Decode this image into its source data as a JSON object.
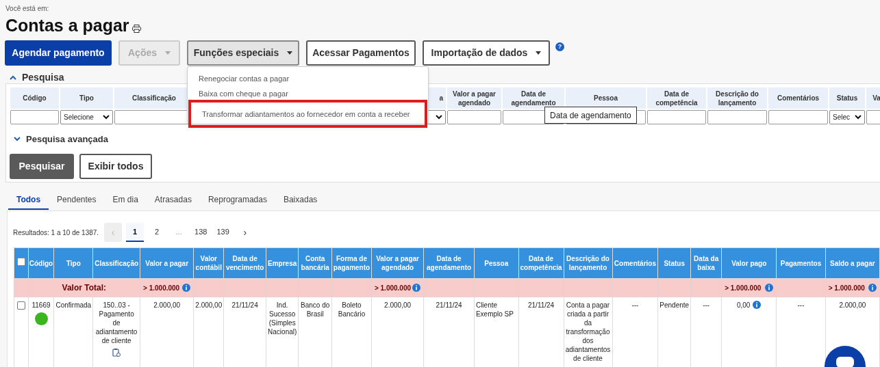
{
  "breadcrumb": "Você está em:",
  "title": "Contas a pagar",
  "toolbar": [
    {
      "label": "Agendar pagamento",
      "kind": "primary",
      "caret": false
    },
    {
      "label": "Ações",
      "kind": "disabled",
      "caret": true
    },
    {
      "label": "Funções especiais",
      "kind": "pressed",
      "caret": true
    },
    {
      "label": "Acessar Pagamentos",
      "kind": "outline",
      "caret": false
    },
    {
      "label": "Importação de dados",
      "kind": "outline",
      "caret": true
    }
  ],
  "menu": [
    {
      "label": "Renegociar contas a pagar",
      "selected": false
    },
    {
      "label": "Baixa com cheque a pagar",
      "selected": false
    },
    {
      "label": "Transformar adiantamentos ao fornecedor em conta a receber",
      "selected": true
    }
  ],
  "search": {
    "title": "Pesquisa",
    "expanded": true
  },
  "filters": [
    {
      "label": "Código",
      "kind": "text"
    },
    {
      "label": "Tipo",
      "kind": "select",
      "value": "Selecione"
    },
    {
      "label": "Classificação",
      "kind": "text"
    },
    {
      "label": "a",
      "kind": "select"
    },
    {
      "label": "Valor a pagar agendado",
      "kind": "text"
    },
    {
      "label": "Data de agendamento",
      "kind": "text"
    },
    {
      "label": "Pessoa",
      "kind": "text"
    },
    {
      "label": "Data de competência",
      "kind": "text"
    },
    {
      "label": "Descrição do lançamento",
      "kind": "text"
    },
    {
      "label": "Comentários",
      "kind": "text"
    },
    {
      "label": "Status",
      "kind": "select",
      "value": "Selec"
    },
    {
      "label": "Va",
      "kind": "text"
    }
  ],
  "tooltip": "Data de agendamento",
  "advanced_search": {
    "title": "Pesquisa avançada",
    "expanded": false
  },
  "actions": [
    {
      "label": "Pesquisar",
      "kind": "dark"
    },
    {
      "label": "Exibir todos",
      "kind": "outline"
    }
  ],
  "tabs": [
    {
      "label": "Todos",
      "selected": true
    },
    {
      "label": "Pendentes",
      "selected": false
    },
    {
      "label": "Em dia",
      "selected": false
    },
    {
      "label": "Atrasadas",
      "selected": false
    },
    {
      "label": "Reprogramadas",
      "selected": false
    },
    {
      "label": "Baixadas",
      "selected": false
    }
  ],
  "results": "Resultados: 1 a 10 de 1387.",
  "pagination": {
    "prev": {
      "label": "‹",
      "disabled": true
    },
    "pages": [
      {
        "label": "1",
        "kind": "page",
        "selected": true
      },
      {
        "label": "2",
        "kind": "page",
        "selected": false
      },
      {
        "label": "...",
        "kind": "ellipsis",
        "selected": false
      },
      {
        "label": "138",
        "kind": "page",
        "selected": false
      },
      {
        "label": "139",
        "kind": "page",
        "selected": false
      }
    ],
    "next": {
      "label": "›",
      "disabled": false
    }
  },
  "table": {
    "select_all": false,
    "columns": [
      {
        "label": "Código"
      },
      {
        "label": "Tipo"
      },
      {
        "label": "Classificação"
      },
      {
        "label": "Valor a pagar",
        "total": "> 1.000.000"
      },
      {
        "label": "Valor contábil"
      },
      {
        "label": "Data de vencimento"
      },
      {
        "label": "Empresa"
      },
      {
        "label": "Conta bancária"
      },
      {
        "label": "Forma de pagamento"
      },
      {
        "label": "Valor a pagar agendado",
        "total": "> 1.000.000"
      },
      {
        "label": "Data de agendamento"
      },
      {
        "label": "Pessoa"
      },
      {
        "label": "Data de competência"
      },
      {
        "label": "Descrição do lançamento"
      },
      {
        "label": "Comentários"
      },
      {
        "label": "Status"
      },
      {
        "label": "Data da baixa"
      },
      {
        "label": "Valor pago",
        "total": "> 1.000.000"
      },
      {
        "label": "Pagamentos"
      },
      {
        "label": "Saldo a pagar",
        "total": "> 1.000.000"
      }
    ],
    "total_label": "Valor Total:",
    "rows": [
      {
        "checked": false,
        "color": "#3cb521",
        "cells": [
          "11669",
          "Confirmada",
          "150..03 - Pagamento de adiantamento de cliente",
          "2.000,00",
          "2.000,00",
          "21/11/24",
          "Ind. Sucesso (Simples Nacional)",
          "Banco do Brasil",
          "Boleto Bancário",
          "2.000,00",
          "21/11/24",
          "Cliente Exemplo SP",
          "21/11/24",
          "Conta a pagar criada a partir da transformação dos adiantamentos de cliente",
          "---",
          "Pendente",
          "---",
          "0,00",
          "---",
          "2.000,00"
        ]
      }
    ]
  },
  "help": "?"
}
